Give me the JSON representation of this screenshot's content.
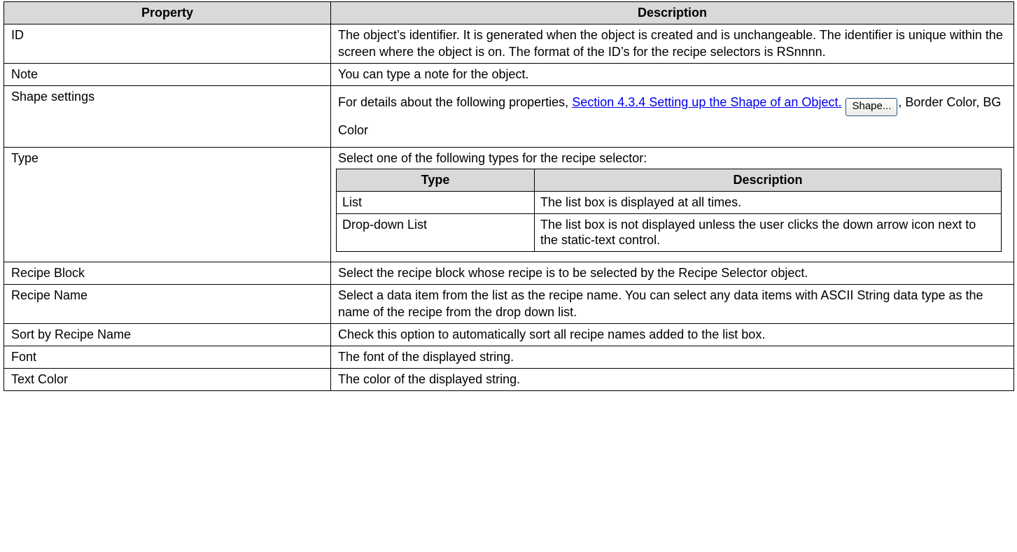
{
  "header": {
    "property": "Property",
    "description": "Description"
  },
  "rows": [
    {
      "property": "ID",
      "description": "The object’s identifier. It is generated when the object is created and is unchangeable. The identifier is unique within the screen where the object is on. The format of the ID’s for the recipe selectors is RSnnnn."
    },
    {
      "property": "Note",
      "description": "You can type a note for the object."
    },
    {
      "property": "Shape settings",
      "description_prefix": "For details about the following properties, ",
      "link_text": "Section 4.3.4 Setting up the Shape of an Object.",
      "button_label": "Shape...",
      "description_suffix": ", Border Color, BG Color"
    },
    {
      "property": "Type",
      "description": "Select one of the following types for the recipe selector:",
      "subtable": {
        "header": {
          "type": "Type",
          "description": "Description"
        },
        "rows": [
          {
            "type": "List",
            "description": "The list box is displayed at all times."
          },
          {
            "type": "Drop-down List",
            "description": "The list box is not displayed unless the user clicks the down arrow icon next to the static-text control."
          }
        ]
      }
    },
    {
      "property": "Recipe Block",
      "description": "Select the recipe block whose recipe is to be selected by the Recipe Selector object."
    },
    {
      "property": "Recipe Name",
      "description": "Select a data item from the list as the recipe name. You can select any data items with ASCII String data type as the name of the recipe from the drop down list."
    },
    {
      "property": "Sort by Recipe Name",
      "description": "Check this option to automatically sort all recipe names added to the list box."
    },
    {
      "property": "Font",
      "description": "The font of the displayed string."
    },
    {
      "property": "Text Color",
      "description": "The color of the displayed string."
    }
  ]
}
